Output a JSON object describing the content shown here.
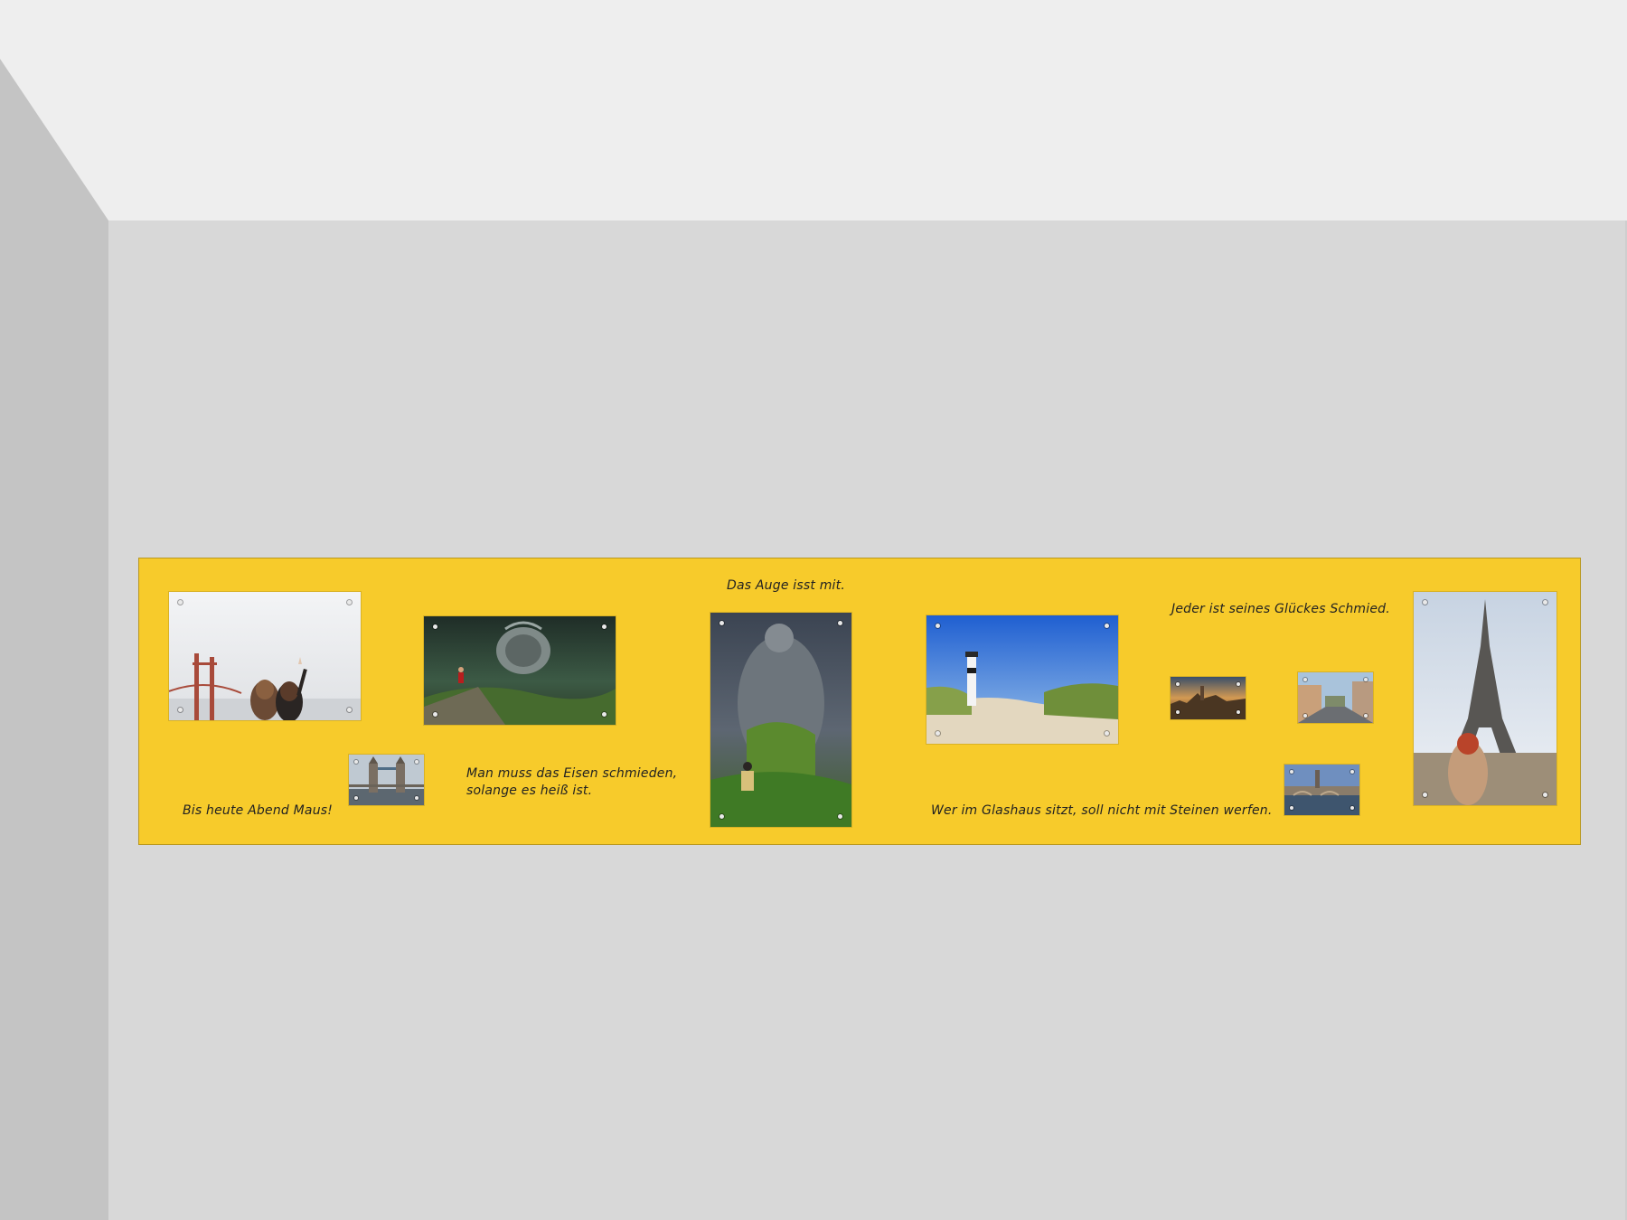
{
  "captions": {
    "bis_heute": "Bis heute Abend Maus!",
    "eisen": "Man muss das Eisen schmieden,\nsolange es heiß ist.",
    "auge": "Das Auge isst mit.",
    "gluecks": "Jeder ist seines Glückes Schmied.",
    "glashaus": "Wer im Glashaus sitzt, soll nicht mit Steinen werfen."
  },
  "colors": {
    "board": "#f7cb2b",
    "wall": "#d8d8d8",
    "ceiling": "#eeeeee",
    "side_wall": "#c4c4c4"
  },
  "icons": {
    "panel_1": "golden-gate-friends-photo",
    "panel_2": "fantasy-helmet-landscape-photo",
    "panel_3": "tower-bridge-photo",
    "panel_4": "stone-statue-girl-photo",
    "panel_5": "lighthouse-dunes-photo",
    "panel_6": "city-sunset-photo",
    "panel_7": "street-scene-photo",
    "panel_8": "bridge-river-photo",
    "panel_9": "eiffel-tower-photo"
  }
}
